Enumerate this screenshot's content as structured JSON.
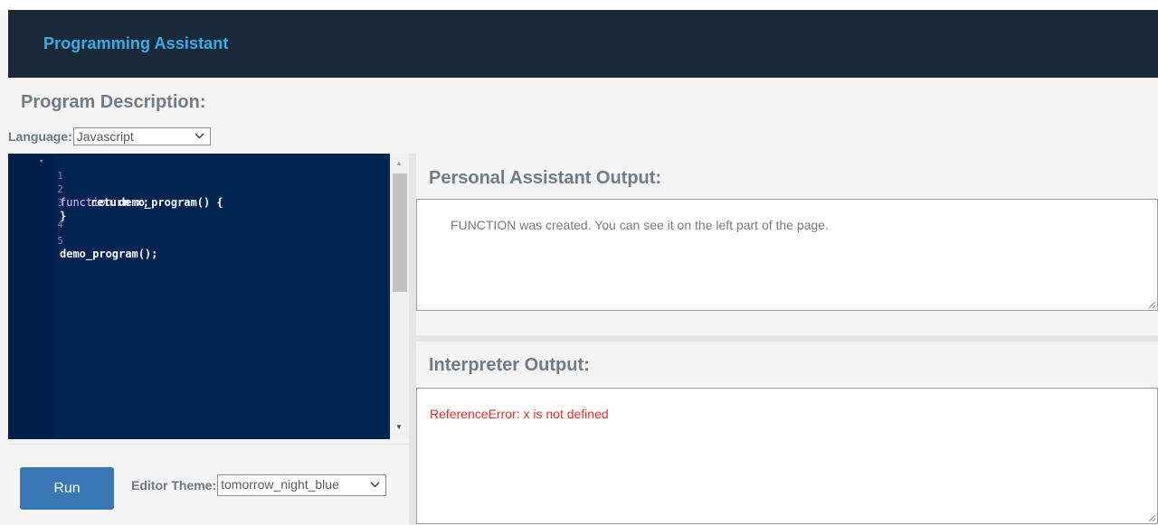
{
  "app": {
    "title": "Programming Assistant"
  },
  "description": {
    "title": "Program Description:"
  },
  "language": {
    "label": "Language:",
    "selected": "Javascript"
  },
  "editor": {
    "lines": [
      {
        "num": "1",
        "fold": true
      },
      {
        "num": "2"
      },
      {
        "num": "3"
      },
      {
        "num": "4"
      },
      {
        "num": "5"
      }
    ],
    "code": {
      "l1_kw": "function",
      "l1_rest": " demo_program() {",
      "l2_kw": "return",
      "l2_rest": " x;",
      "l3": "}",
      "l5": "demo_program();"
    }
  },
  "controls": {
    "run_label": "Run",
    "theme_label": "Editor Theme:",
    "theme_selected": "tomorrow_night_blue"
  },
  "assistant": {
    "title": "Personal Assistant Output:",
    "text": "FUNCTION was created. You can see it on the left part of the page."
  },
  "interpreter": {
    "title": "Interpreter Output:",
    "text": "ReferenceError: x is not defined",
    "error_color": "#e52d2d"
  },
  "colors": {
    "navbar_bg": "#1b2a3a",
    "accent": "#36aee6",
    "editor_bg": "#002451",
    "run_button": "#3a78b4"
  }
}
